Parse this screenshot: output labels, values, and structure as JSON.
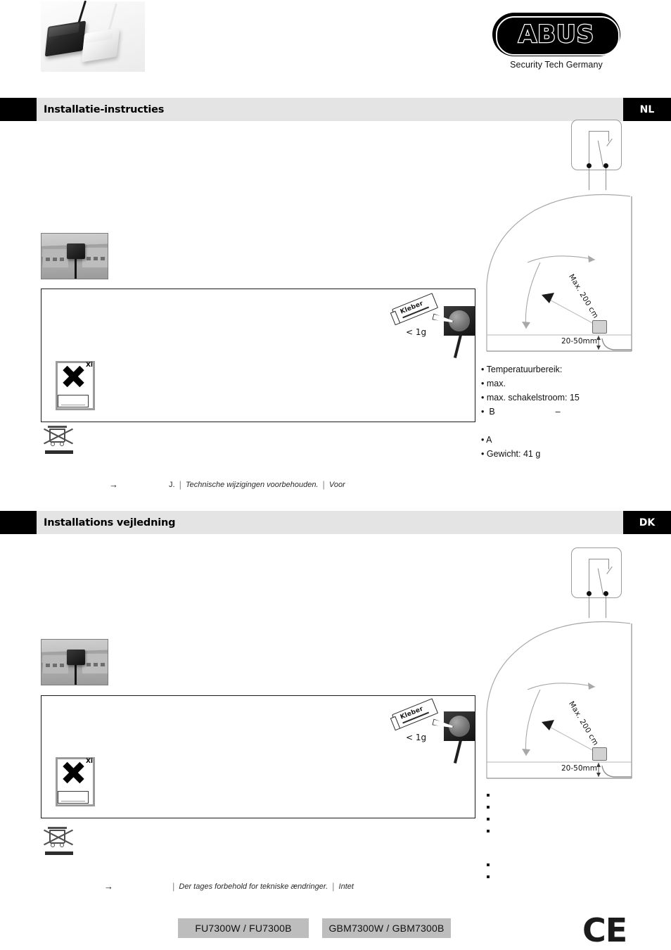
{
  "brand": {
    "name": "ABUS",
    "tagline": "Security Tech Germany",
    "product_photo_alt": "glass-break-sensors-black-white"
  },
  "sections": [
    {
      "id": "nl",
      "title": "Installatie-instructies",
      "code": "NL",
      "diagram": {
        "max_distance_label": "Max. 200 cm",
        "gap_label": "20-50mm"
      },
      "adhesive": {
        "tube_label": "Kleber",
        "amount_label": "< 1g"
      },
      "hazard": {
        "code": "Xi"
      },
      "specs": [
        "Temperatuurbereik:",
        "max.",
        "max. schakelstroom: 15",
        "B"
      ],
      "spec_dash": "–",
      "specs_after": [
        "A",
        "Gewicht: 41 g"
      ],
      "footer": {
        "arrow": "→",
        "lead": "J.",
        "sep": "|",
        "italic_text": "Technische  wijzigingen  voorbehouden.",
        "sep2": "|",
        "tail": "Voor"
      }
    },
    {
      "id": "dk",
      "title": "Installations vejledning",
      "code": "DK",
      "diagram": {
        "max_distance_label": "Max. 200 cm",
        "gap_label": "20-50mm"
      },
      "adhesive": {
        "tube_label": "Kleber",
        "amount_label": "< 1g"
      },
      "hazard": {
        "code": "Xi"
      },
      "specs": [
        "",
        "",
        "",
        ""
      ],
      "spec_dash": "",
      "specs_after": [
        "",
        ""
      ],
      "footer": {
        "arrow": "→",
        "lead": "",
        "sep": "|",
        "italic_text": "Der tages forbehold for tekniske ændringer.",
        "sep2": "|",
        "tail": "Intet"
      }
    }
  ],
  "bottom": {
    "model_left": "FU7300W / FU7300B",
    "model_right": "GBM7300W / GBM7300B",
    "ce_mark": "CE"
  }
}
